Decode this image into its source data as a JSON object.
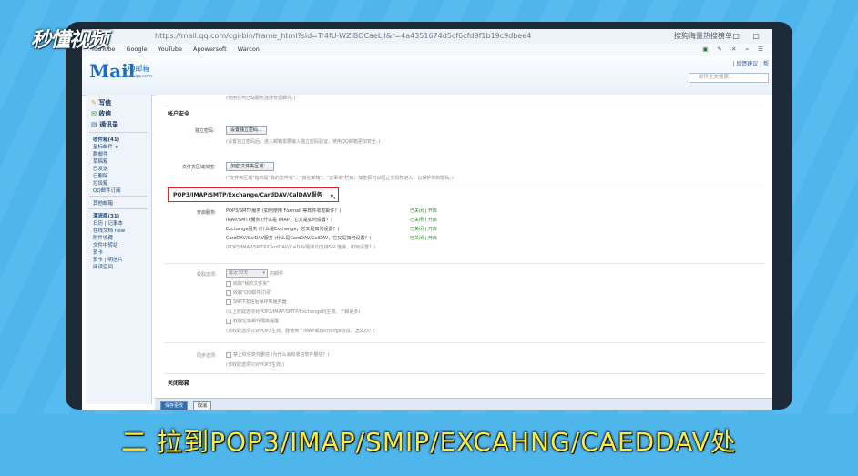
{
  "watermark": "秒懂视频",
  "browser": {
    "url": "https://mail.qq.com/cgi-bin/frame_html?sid=Tr4fU-WZlBOCaeLjI&r=4a4351674d5cf6cfd9f1b19c9dbee4",
    "right_label": "搜狗海量热搜榜单",
    "bookmarks": [
      "YouTube",
      "Google",
      "YouTube",
      "Apowersoft",
      "Warcon"
    ]
  },
  "qq": {
    "logo": "Mail",
    "logo_sub": "QQ邮箱",
    "logo_sub2": "mail.qq.com",
    "top_links": "| 反馈建议 | 帮",
    "search_placeholder": "邮件全文搜索..."
  },
  "sidebar": {
    "write": "写信",
    "receive": "收信",
    "contacts": "通讯录",
    "items1": [
      "收件箱(41)",
      "星标邮件 ★",
      "群邮件",
      "草稿箱",
      "已发送",
      "已删除",
      "垃圾箱",
      "QQ邮件订阅"
    ],
    "items2": [
      "其他邮箱"
    ],
    "items3": [
      "漂流瓶(31)",
      "日历 | 记事本",
      "在线文档 new",
      "附件收藏",
      "文件中转站",
      "贺卡",
      "贺卡 | 明信片",
      "阅读空间"
    ]
  },
  "content": {
    "top_note": "(使用任何已站服务连接管理邮件。)",
    "account_security": "帐户安全",
    "independent_pwd_label": "独立密码:",
    "independent_pwd_btn": "设置独立密码...",
    "independent_pwd_note": "(设置独立密码后，进入邮箱需要输入独立密码验证，使用QQ邮箱更加安全。)",
    "file_area_label": "文件夹区域加密:",
    "file_area_btn": "加密'文件夹区域'...",
    "file_area_note": "(\"文件夹区域\"指的是\"我的文件夹\"、\"其他邮箱\"、\"记事本\"栏目，加密即可以阻止非授权进入，以保护你的隐私。)",
    "pop_header": "POP3/IMAP/SMTP/Exchange/CardDAV/CalDAV服务",
    "enable_label": "开启服务:",
    "services": [
      {
        "name": "POP3/SMTP服务 (如何使用 Foxmail 等软件收发邮件？)",
        "status": "已关闭 | 开启"
      },
      {
        "name": "IMAP/SMTP服务 (什么是 IMAP，它又是如何设置？)",
        "status": "已关闭 | 开启"
      },
      {
        "name": "Exchange服务 (什么是Exchange，它又是如何设置？)",
        "status": "已关闭 | 开启"
      },
      {
        "name": "CardDAV/CalDAV服务 (什么是CardDAV/CalDAV，它又是如何设置？)",
        "status": "已关闭 | 开启"
      }
    ],
    "services_note": "(POP3/IMAP/SMTP/CardDAV/CalDAV服务均支持SSL连接。如何设置？)",
    "recv_label": "收取选项:",
    "recv_select": "最近30天",
    "recv_select_suffix": "的邮件",
    "recv_opts": [
      "收取\"我的文件夹\"",
      "收取\"QQ邮件订阅\"",
      "SMTP发信后保存到服务器"
    ],
    "recv_note1": "(以上收取选项对POP3/IMAP/SMTP/Exchange均生效。了解更多)",
    "recv_opt4": "收取垃圾邮件隔离提醒",
    "recv_note2": "(该收取选项只对POP3生效。我使用了IMAP或Exchange协议，怎么办？)",
    "sync_label": "同步选项:",
    "sync_opt": "禁止收信软件删信 (为什么会有收信软件删信？)",
    "sync_note": "(该收取选项只对POP3生效。)",
    "close_mail": "关闭邮箱"
  },
  "footer": {
    "save": "保存更改",
    "cancel": "取消"
  },
  "subtitle": "二 拉到POP3/IMAP/SMIP/EXCAHNG/CAEDDAV处"
}
